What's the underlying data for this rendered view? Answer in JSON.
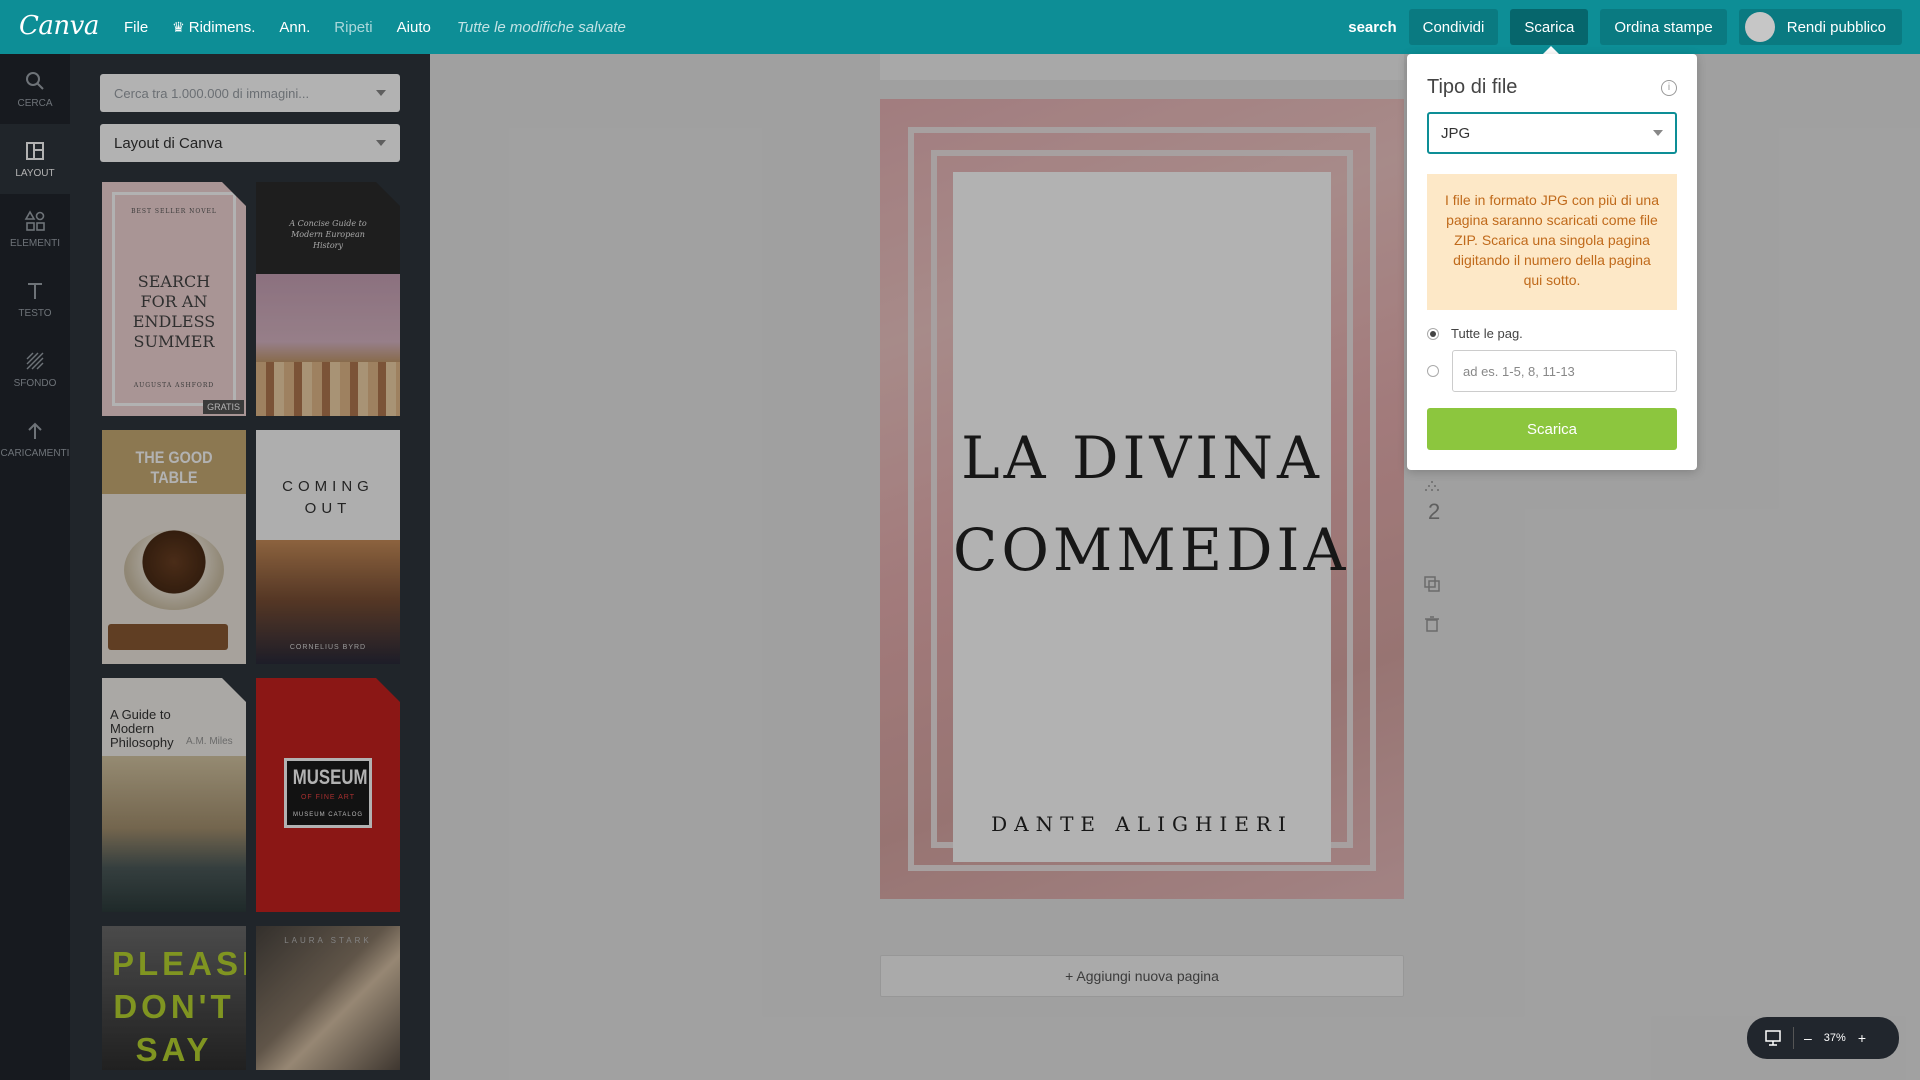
{
  "header": {
    "logo": "Canva",
    "menu": [
      {
        "label": "File",
        "dim": false
      },
      {
        "label": "Ridimens.",
        "dim": false
      },
      {
        "label": "Ann.",
        "dim": false
      },
      {
        "label": "Ripeti",
        "dim": true
      },
      {
        "label": "Aiuto",
        "dim": false
      }
    ],
    "saved_status": "Tutte le modifiche salvate",
    "search_label": "search",
    "share_label": "Condividi",
    "download_label": "Scarica",
    "print_label": "Ordina stampe",
    "publish_label": "Rendi pubblico"
  },
  "sidebar": {
    "items": [
      {
        "label": "CERCA",
        "icon": "search-icon"
      },
      {
        "label": "LAYOUT",
        "icon": "layout-icon"
      },
      {
        "label": "ELEMENTI",
        "icon": "elements-icon"
      },
      {
        "label": "TESTO",
        "icon": "text-icon"
      },
      {
        "label": "SFONDO",
        "icon": "background-icon"
      },
      {
        "label": "CARICAMENTI",
        "icon": "upload-icon"
      }
    ]
  },
  "panel": {
    "search_placeholder": "Cerca tra 1.000.000 di immagini...",
    "layout_select": "Layout di Canva",
    "templates": [
      {
        "top_text": "BEST SELLER NOVEL",
        "title": "SEARCH FOR AN ENDLESS SUMMER",
        "bottom_text": "AUGUSTA ASHFORD",
        "badge": "GRATIS"
      },
      {
        "top_text": "",
        "title": "A Concise Guide to Modern European History",
        "bottom_text": "",
        "badge": ""
      },
      {
        "top_text": "",
        "title": "THE GOOD TABLE",
        "bottom_text": "",
        "badge": ""
      },
      {
        "top_text": "",
        "title": "COMING OUT",
        "bottom_text": "CORNELIUS BYRD",
        "badge": ""
      },
      {
        "top_text": "",
        "title": "A Guide to Modern Philosophy",
        "bottom_text": "A.M. Miles",
        "badge": ""
      },
      {
        "top_text": "",
        "title": "MUSEUM",
        "subtitle": "OF FINE ART",
        "bottom_text": "MUSEUM CATALOG",
        "badge": ""
      },
      {
        "top_text": "",
        "title": "PLEASE DON'T SAY YOU",
        "bottom_text": "",
        "badge": ""
      },
      {
        "top_text": "LAURA STARK",
        "title": "",
        "bottom_text": "",
        "badge": ""
      }
    ]
  },
  "canvas": {
    "title_line1": "LA DIVINA",
    "title_line2": "COMMEDIA",
    "author": "DANTE ALIGHIERI",
    "add_page": "+ Aggiungi nuova pagina",
    "page_number": "2",
    "zoom": "37%"
  },
  "download_popover": {
    "title": "Tipo di file",
    "file_type": "JPG",
    "warning": "I file in formato JPG con più di una pagina saranno scaricati come file ZIP. Scarica una singola pagina digitando il numero della pagina qui sotto.",
    "option_all": "Tutte le pag.",
    "range_placeholder": "ad es. 1-5, 8, 11-13",
    "download_button": "Scarica"
  },
  "colors": {
    "brand": "#0d8e96",
    "download_green": "#8cc63e",
    "warning_bg": "#fde8c7"
  }
}
